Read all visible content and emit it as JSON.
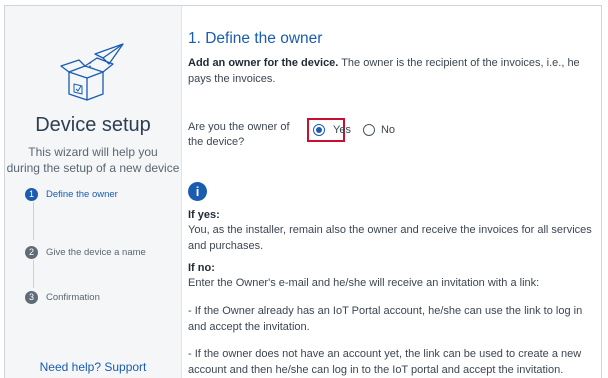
{
  "sidebar": {
    "title": "Device setup",
    "subtitle_line1": "This wizard will help you",
    "subtitle_line2": "during the setup of a new device",
    "steps": [
      {
        "number": "1",
        "label": "Define the owner",
        "active": true
      },
      {
        "number": "2",
        "label": "Give the device a name",
        "active": false
      },
      {
        "number": "3",
        "label": "Confirmation",
        "active": false
      }
    ],
    "support_link": "Need help? Support",
    "illustration_icon": "open-box-with-paper-plane-icon"
  },
  "main": {
    "section_title": "1. Define the owner",
    "intro_bold": "Add an owner for the device.",
    "intro_text": " The owner is the recipient of the invoices, i.e., he pays the invoices.",
    "question": "Are you the owner of the device?",
    "options": {
      "yes": "Yes",
      "no": "No"
    },
    "selected": "yes",
    "info_icon": "info-icon",
    "if_yes_heading": "If yes:",
    "if_yes_text": "You, as the installer, remain also the owner and receive the invoices for all services and purchases.",
    "if_no_heading": "If no:",
    "if_no_text": "Enter the Owner's e-mail and he/she will receive an invitation with a link:",
    "bullet1": "- If the Owner already has an IoT Portal account, he/she can use the link to log in and accept the invitation.",
    "bullet2": "- If the owner does not have an account yet, the link can be used to create a new account and then he/she can log in to the IoT portal and accept the invitation."
  },
  "colors": {
    "accent": "#1a5cb0",
    "highlight": "#c8102e",
    "sidebar_bg": "#f4f6f8"
  }
}
